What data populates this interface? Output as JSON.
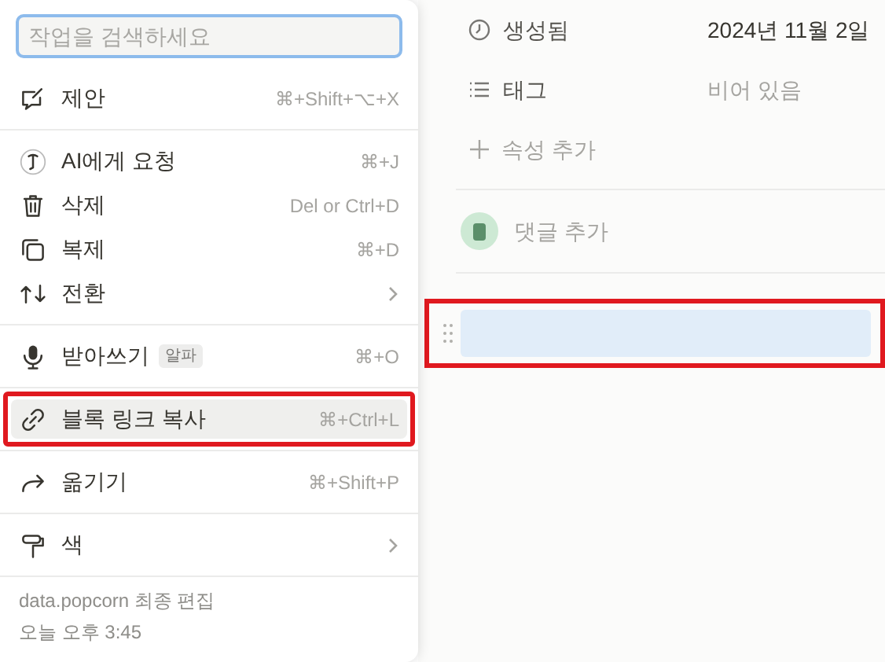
{
  "menu": {
    "search": {
      "placeholder": "작업을 검색하세요"
    },
    "groups": [
      [
        {
          "label": "제안",
          "shortcut": "⌘+Shift+⌥+X",
          "highlighted": false,
          "annotated": false
        }
      ],
      [
        {
          "label": "AI에게 요청",
          "shortcut": "⌘+J",
          "highlighted": false,
          "annotated": false
        },
        {
          "label": "삭제",
          "shortcut": "Del or Ctrl+D",
          "highlighted": false,
          "annotated": false
        },
        {
          "label": "복제",
          "shortcut": "⌘+D",
          "highlighted": false,
          "annotated": false
        },
        {
          "label": "전환",
          "submenu": true,
          "highlighted": false,
          "annotated": false
        }
      ],
      [
        {
          "label": "받아쓰기",
          "badge": "알파",
          "shortcut": "⌘+O",
          "highlighted": false,
          "annotated": false
        }
      ],
      [
        {
          "label": "블록 링크 복사",
          "shortcut": "⌘+Ctrl+L",
          "highlighted": true,
          "annotated": true
        }
      ],
      [
        {
          "label": "옮기기",
          "shortcut": "⌘+Shift+P",
          "highlighted": false,
          "annotated": false
        }
      ],
      [
        {
          "label": "색",
          "submenu": true,
          "highlighted": false,
          "annotated": false
        }
      ]
    ],
    "footer": [
      "data.popcorn 최종 편집",
      "오늘 오후 3:45"
    ]
  },
  "page": {
    "properties": [
      {
        "name": "생성됨",
        "value": "2024년 11월 2일",
        "empty": false
      },
      {
        "name": "태그",
        "value": "비어 있음",
        "empty": true
      }
    ],
    "add_property": "속성 추가",
    "add_comment": "댓글 추가",
    "block": {
      "selected": true,
      "annotated": true
    }
  }
}
